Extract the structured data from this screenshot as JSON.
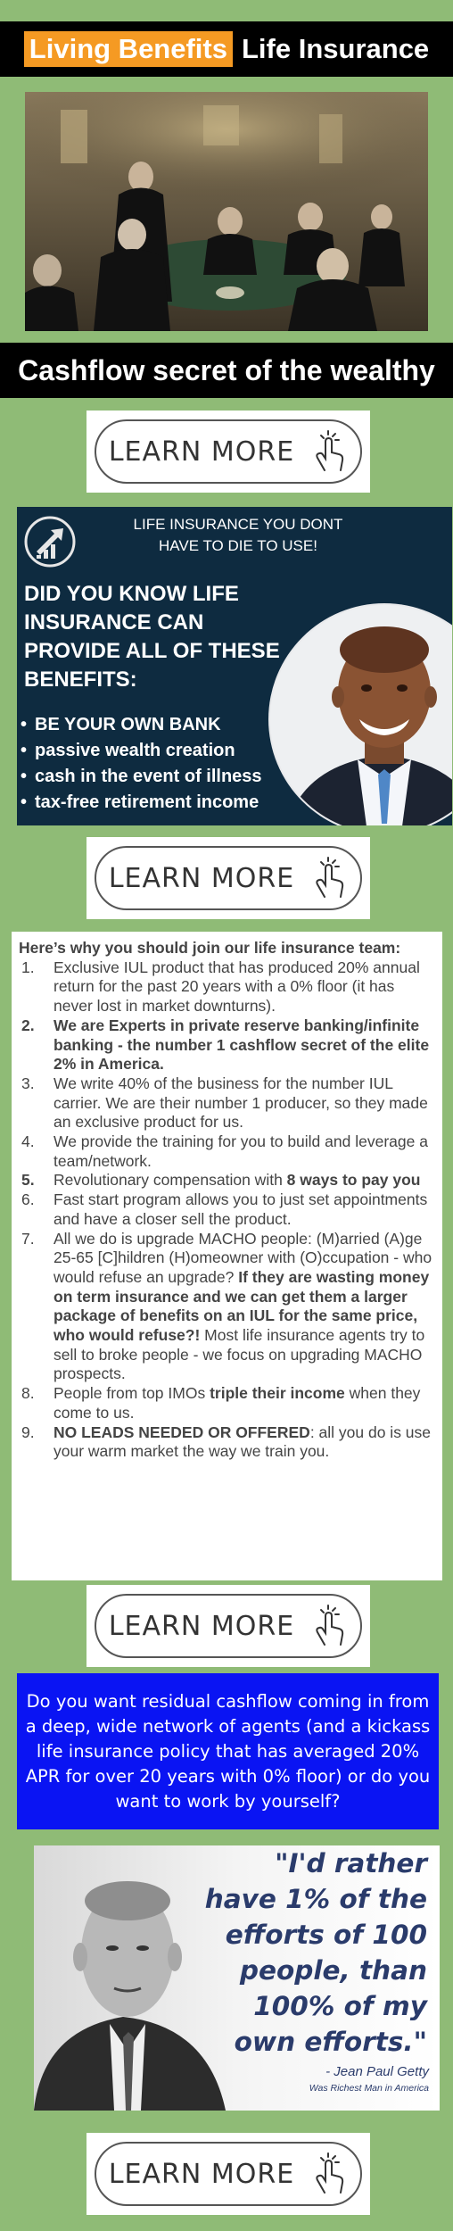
{
  "header": {
    "highlight": "Living Benefits",
    "title": "Life Insurance"
  },
  "tagline": "Cashflow secret of the wealthy",
  "learn_more_label": "LEARN MORE",
  "banner": {
    "headline": "LIFE INSURANCE YOU DONT HAVE TO DIE TO USE!",
    "question": "DID YOU KNOW  LIFE INSURANCE CAN PROVIDE ALL OF THESE BENEFITS:",
    "benefits": [
      "BE YOUR OWN BANK",
      "passive wealth creation",
      "cash in the event of illness",
      "tax-free retirement income"
    ]
  },
  "reasons": {
    "title": "Here’s why you should join our life insurance team:",
    "items": [
      {
        "num": "1.",
        "parts": [
          {
            "t": "Exclusive IUL product that has produced 20% annual return for the past 20 years with a 0% floor (it has never lost in market downturns).",
            "b": false
          }
        ]
      },
      {
        "num": "2.",
        "numBold": true,
        "parts": [
          {
            "t": "We are Experts in private reserve banking/infinite banking - the number 1 cashflow secret of the elite 2% in America.",
            "b": true
          }
        ]
      },
      {
        "num": "3.",
        "parts": [
          {
            "t": "We write 40% of the business for the number IUL carrier. We are their number 1 producer, so they made an exclusive product for us.",
            "b": false
          }
        ]
      },
      {
        "num": "4.",
        "parts": [
          {
            "t": "We provide the training for you to build and leverage a team/network.",
            "b": false
          }
        ]
      },
      {
        "num": "5.",
        "numBold": true,
        "parts": [
          {
            "t": "Revolutionary compensation with ",
            "b": false
          },
          {
            "t": "8 ways to pay you",
            "b": true
          }
        ]
      },
      {
        "num": "6.",
        "parts": [
          {
            "t": "Fast start program allows you to just set appointments and have a closer sell the product.",
            "b": false
          }
        ]
      },
      {
        "num": "7.",
        "parts": [
          {
            "t": "All we do is upgrade MACHO people: (M)arried (A)ge 25-65 [C]hildren (H)omeowner with (O)ccupation - who would refuse an upgrade? ",
            "b": false
          },
          {
            "t": "If they are wasting money on term insurance and we can get them a larger package of benefits on an IUL for the same price, who would refuse?!",
            "b": true
          },
          {
            "t": " Most life insurance agents try to sell to broke people - we focus on upgrading MACHO prospects.",
            "b": false
          }
        ]
      },
      {
        "num": "8.",
        "parts": [
          {
            "t": "People from top IMOs ",
            "b": false
          },
          {
            "t": "triple their income",
            "b": true
          },
          {
            "t": " when they come to us.",
            "b": false
          }
        ]
      },
      {
        "num": "9.",
        "parts": [
          {
            "t": "NO LEADS NEEDED OR OFFERED",
            "b": true
          },
          {
            "t": ": all you do is use your warm market the way we train you.",
            "b": false
          }
        ]
      }
    ]
  },
  "cta_text": "Do you want residual cashflow coming in from a deep, wide network of agents (and a kickass life insurance policy that has averaged 20% APR for over 20 years with 0% floor) or do you want to work by yourself?",
  "quote": {
    "text": "\"I'd rather have 1% of the efforts of 100 people, than 100% of my own efforts.\"",
    "author": "- Jean Paul Getty",
    "subtitle": "Was Richest Man in America"
  },
  "colors": {
    "background": "#8fbb76",
    "highlight": "#f59a23",
    "banner": "#0e2b40",
    "cta": "#0a14f3",
    "quote_text": "#2a3b6b"
  }
}
